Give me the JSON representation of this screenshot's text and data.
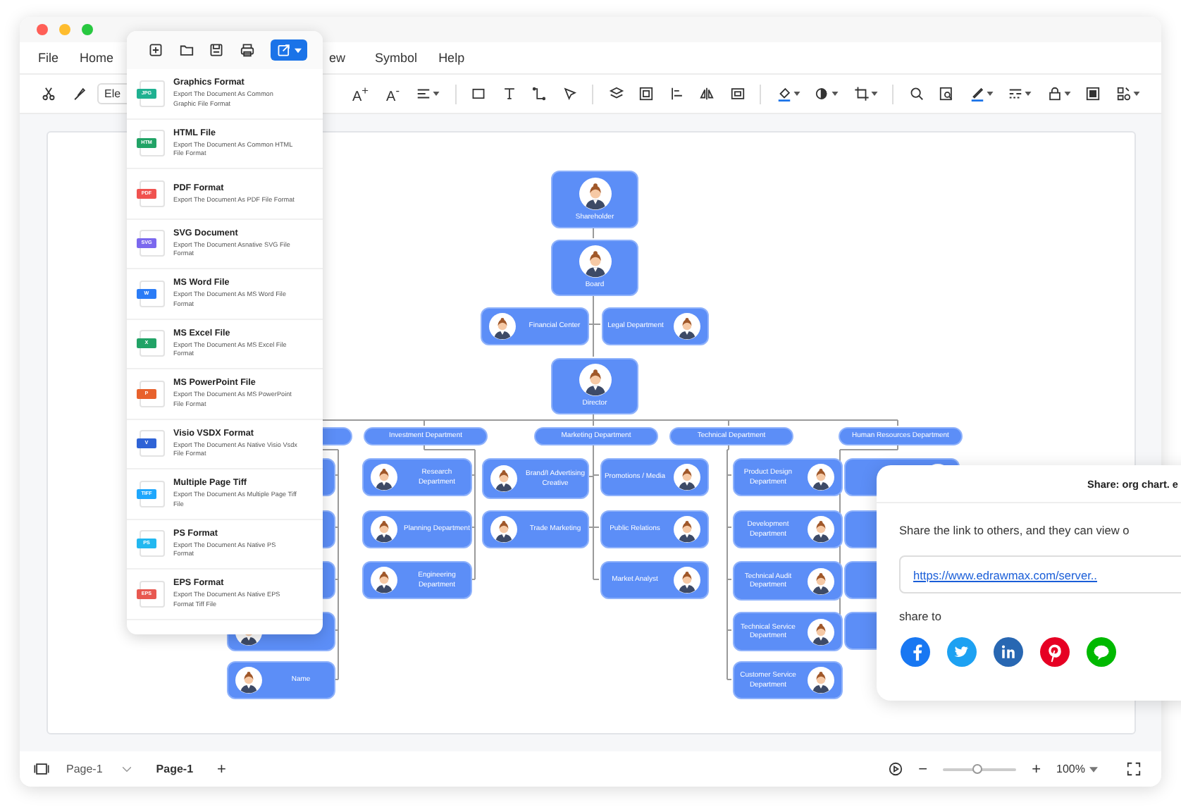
{
  "menu": [
    "File",
    "Home",
    "ew",
    "Symbol",
    "Help"
  ],
  "toolbar": {
    "font_field": "Ele",
    "grow": "A$^{+}$",
    "shrink": "A$^{-}$"
  },
  "export_menu": {
    "items": [
      {
        "title": "Graphics Format",
        "description": "Export The Document As Common Graphic File Format",
        "badge": "JPG",
        "color": "#1fb191"
      },
      {
        "title": "HTML File",
        "description": "Export The Document As Common HTML File Format",
        "badge": "HTM",
        "color": "#21a366"
      },
      {
        "title": "PDF Format",
        "description": "Export The Document As PDF File Format",
        "badge": "PDF",
        "color": "#f0524f"
      },
      {
        "title": "SVG Document",
        "description": "Export The Document Asnative SVG File Format",
        "badge": "SVG",
        "color": "#7b68ee"
      },
      {
        "title": "MS Word File",
        "description": "Export The Document As MS Word File Format",
        "badge": "W",
        "color": "#2b7cf6"
      },
      {
        "title": "MS Excel File",
        "description": "Export The Document As MS Excel File Format",
        "badge": "X",
        "color": "#21a366"
      },
      {
        "title": "MS PowerPoint File",
        "description": "Export The Document As MS PowerPoint File Format",
        "badge": "P",
        "color": "#e8612c"
      },
      {
        "title": "Visio VSDX Format",
        "description": "Export The Document As Native Visio Vsdx File Format",
        "badge": "V",
        "color": "#2f63d6"
      },
      {
        "title": "Multiple Page Tiff",
        "description": "Export The Document As Multiple Page Tiff File",
        "badge": "TIFF",
        "color": "#1ea7fd"
      },
      {
        "title": "PS Format",
        "description": "Export The Document As Native PS Format",
        "badge": "PS",
        "color": "#22b8f0"
      },
      {
        "title": "EPS Format",
        "description": "Export The Document As Native EPS Format Tiff File",
        "badge": "EPS",
        "color": "#e85850"
      }
    ]
  },
  "org_chart": {
    "nodes": [
      {
        "kind": "top",
        "label": "Shareholder"
      },
      {
        "kind": "top",
        "label": "Board"
      },
      {
        "kind": "avatar-left",
        "label": "Financial Center"
      },
      {
        "kind": "avatar-right",
        "label": "Legal Department"
      },
      {
        "kind": "top",
        "label": "Director"
      },
      {
        "kind": "header"
      },
      {
        "kind": "header",
        "label": "Investment Department"
      },
      {
        "kind": "header",
        "label": "Marketing Department"
      },
      {
        "kind": "header",
        "label": "Technical Department"
      },
      {
        "kind": "header",
        "label": "Human Resources Department"
      },
      {
        "kind": "avatar-left"
      },
      {
        "kind": "avatar-left"
      },
      {
        "kind": "avatar-left"
      },
      {
        "kind": "avatar-left"
      },
      {
        "kind": "avatar-left",
        "label": "Name"
      },
      {
        "kind": "avatar-left",
        "label": "Research Department"
      },
      {
        "kind": "avatar-left",
        "label": "Planning Department"
      },
      {
        "kind": "avatar-left",
        "label": "Engineering Department"
      },
      {
        "kind": "avatar-left",
        "label": "Brand/I Advertising Creative"
      },
      {
        "kind": "avatar-left",
        "label": "Trade Marketing"
      },
      {
        "kind": "avatar-right",
        "label": "Promotions / Media"
      },
      {
        "kind": "avatar-right",
        "label": "Public Relations"
      },
      {
        "kind": "avatar-right",
        "label": "Market Analyst"
      },
      {
        "kind": "avatar-right",
        "label": "Product Design Department"
      },
      {
        "kind": "avatar-right",
        "label": "Development Department"
      },
      {
        "kind": "avatar-right",
        "label": "Technical Audit Department"
      },
      {
        "kind": "avatar-right",
        "label": "Technical Service Department"
      },
      {
        "kind": "avatar-right",
        "label": "Customer Service Department"
      },
      {
        "kind": "avatar-right"
      },
      {
        "kind": "avatar-right"
      },
      {
        "kind": "avatar-right"
      },
      {
        "kind": "avatar-right"
      }
    ]
  },
  "share": {
    "title": "Share: org chart. e",
    "message": "Share the link to others, and they can view o",
    "link": "https://www.edrawmax.com/server..",
    "label": "share to",
    "networks": [
      {
        "kind": "facebook",
        "color": "#1877f2"
      },
      {
        "kind": "twitter",
        "color": "#1da1f2"
      },
      {
        "kind": "linkedin",
        "color": "#2867b2"
      },
      {
        "kind": "pinterest",
        "color": "#e60023"
      },
      {
        "kind": "line",
        "color": "#00b900"
      }
    ]
  },
  "status_bar": {
    "page_select": "Page-1",
    "page_tab": "Page-1",
    "add": "+",
    "zoom_out": "−",
    "zoom_in": "+",
    "zoom": "100%",
    "level": 0.48
  }
}
